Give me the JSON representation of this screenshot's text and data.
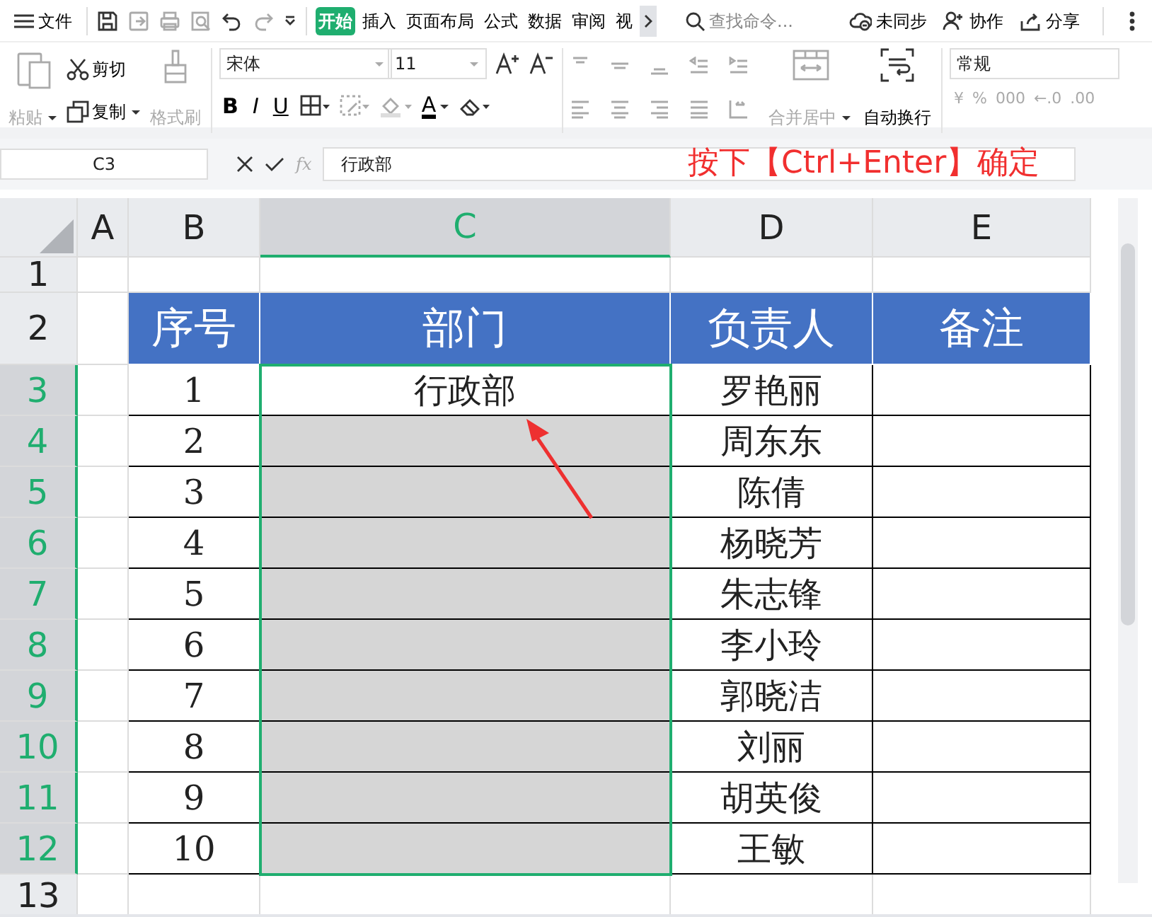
{
  "menu_bar": {
    "file_label": "文件",
    "tabs": [
      {
        "label": "开始",
        "selected": true
      },
      {
        "label": "插入",
        "selected": false
      },
      {
        "label": "页面布局",
        "selected": false
      },
      {
        "label": "公式",
        "selected": false
      },
      {
        "label": "数据",
        "selected": false
      },
      {
        "label": "审阅",
        "selected": false
      },
      {
        "label": "视",
        "selected": false
      }
    ],
    "search": {
      "placeholder": "查找命令..."
    },
    "actions": [
      {
        "kind": "sync",
        "label": "未同步"
      },
      {
        "kind": "collab",
        "label": "协作"
      },
      {
        "kind": "share",
        "label": "分享"
      }
    ]
  },
  "ribbon": {
    "paste": {
      "label": "粘贴",
      "disabled": true
    },
    "cut": {
      "label": "剪切",
      "disabled": false
    },
    "copy": {
      "label": "复制",
      "disabled": false
    },
    "format_painter": {
      "label": "格式刷",
      "disabled": true
    },
    "font_name": "宋体",
    "font_size": "11",
    "font_styles": [
      "B",
      "I",
      "U"
    ],
    "font_color_glyph": "A",
    "merge": {
      "label": "合并居中",
      "disabled": true
    },
    "wrap": {
      "label": "自动换行",
      "disabled": false
    },
    "number_format": "常规",
    "number_buttons": [
      "¥",
      "%",
      "000",
      "←.0",
      ".00"
    ]
  },
  "formula_bar": {
    "cell_ref": "C3",
    "fx": "fx",
    "value": "行政部"
  },
  "annotation": "按下【Ctrl+Enter】确定",
  "sheet": {
    "columns": [
      {
        "label": "A",
        "selected": false
      },
      {
        "label": "B",
        "selected": false
      },
      {
        "label": "C",
        "selected": true
      },
      {
        "label": "D",
        "selected": false
      },
      {
        "label": "E",
        "selected": false
      }
    ],
    "row_labels": [
      {
        "label": "1",
        "selected": false
      },
      {
        "label": "2",
        "selected": false
      },
      {
        "label": "3",
        "selected": true
      },
      {
        "label": "4",
        "selected": true
      },
      {
        "label": "5",
        "selected": true
      },
      {
        "label": "6",
        "selected": true
      },
      {
        "label": "7",
        "selected": true
      },
      {
        "label": "8",
        "selected": true
      },
      {
        "label": "9",
        "selected": true
      },
      {
        "label": "10",
        "selected": true
      },
      {
        "label": "11",
        "selected": true
      },
      {
        "label": "12",
        "selected": true
      },
      {
        "label": "13",
        "selected": false
      }
    ],
    "table_header": [
      "序号",
      "部门",
      "负责人",
      "备注"
    ],
    "rows": [
      {
        "no": "1",
        "dept": "行政部",
        "person": "罗艳丽",
        "selected": true,
        "active": true
      },
      {
        "no": "2",
        "person": "周东东",
        "selected": true,
        "active": false
      },
      {
        "no": "3",
        "person": "陈倩",
        "selected": true,
        "active": false
      },
      {
        "no": "4",
        "person": "杨晓芳",
        "selected": true,
        "active": false
      },
      {
        "no": "5",
        "person": "朱志锋",
        "selected": true,
        "active": false
      },
      {
        "no": "6",
        "person": "李小玲",
        "selected": true,
        "active": false
      },
      {
        "no": "7",
        "person": "郭晓洁",
        "selected": true,
        "active": false
      },
      {
        "no": "8",
        "person": "刘丽",
        "selected": true,
        "active": false
      },
      {
        "no": "9",
        "person": "胡英俊",
        "selected": true,
        "active": false
      },
      {
        "no": "10",
        "person": "王敏",
        "selected": true,
        "active": false
      }
    ]
  }
}
